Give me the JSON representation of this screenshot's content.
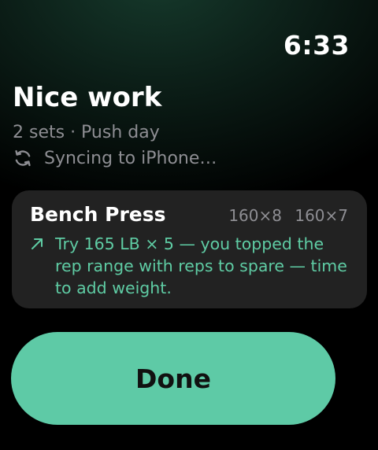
{
  "status": {
    "time": "6:33"
  },
  "summary": {
    "title": "Nice work",
    "subtitle": "2 sets · Push day",
    "sync_text": "Syncing to iPhone…",
    "sync_icon": "sync-icon"
  },
  "exercise_card": {
    "name": "Bench Press",
    "sets": [
      "160×8",
      "160×7"
    ],
    "suggestion_icon": "arrow-up-right-icon",
    "suggestion": "Try 165 LB × 5 — you topped the rep range with reps to spare — time to add weight."
  },
  "actions": {
    "done_label": "Done"
  },
  "colors": {
    "accent": "#5ecaa6",
    "suggestion_text": "#5fcca4",
    "card_background": "#222222",
    "secondary_text": "#8e8e93"
  }
}
